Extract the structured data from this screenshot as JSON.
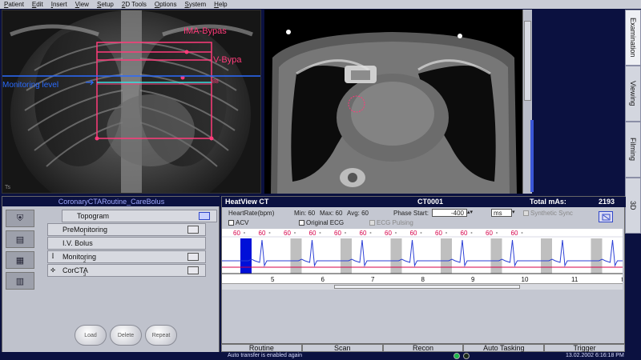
{
  "menu": [
    "Patient",
    "Edit",
    "Insert",
    "View",
    "Setup",
    "2D Tools",
    "Options",
    "System",
    "Help"
  ],
  "topogram": {
    "labels": {
      "ima_bypass": "IMA-Bypas",
      "v_bypass": "V-Bypa",
      "monitoring_level": "Monitoring level",
      "corner_mark": "Ts"
    },
    "colors": {
      "bypass": "#ff3b7a",
      "monitoring": "#2a6bff",
      "cyan": "#3ce0e0"
    }
  },
  "side_tabs": [
    "Examination",
    "Viewing",
    "Filming",
    "3D"
  ],
  "protocol": {
    "title": "CoronaryCTARoutine_CareBolus",
    "rows": [
      {
        "label": "Topogram",
        "num": "",
        "checked": true
      },
      {
        "label": "PreMonitoring",
        "num": "1",
        "checked": false
      },
      {
        "label": "I.V. Bolus",
        "num": "",
        "checked": false
      },
      {
        "label": "Monitoring",
        "num": "2",
        "checked": false
      },
      {
        "label": "CorCTA",
        "num": "3",
        "checked": false
      }
    ],
    "round_buttons": [
      "Load",
      "Delete",
      "Repeat"
    ]
  },
  "heartview": {
    "title": "HeatView CT",
    "id": "CT0001",
    "total_mas_label": "Total mAs:",
    "total_mas_value": "2193",
    "heart_rate_label": "HeartRate(bpm)",
    "min": "Min: 60",
    "max": "Max: 60",
    "avg": "Avg: 60",
    "phase_start_label": "Phase Start:",
    "phase_start_value": "-400",
    "phase_unit": "ms",
    "synthetic_sync": "Synthetic Sync",
    "acv": "ACV",
    "original_ecg": "Original ECG",
    "ecg_pulsing": "ECG Pulsing"
  },
  "ecg_data": {
    "hr_labels": [
      "60",
      "60",
      "60",
      "60",
      "60",
      "60",
      "60",
      "60",
      "60",
      "60",
      "60",
      "60"
    ],
    "beat_numbers": [
      "5",
      "6",
      "7",
      "8",
      "9",
      "10",
      "11",
      "t"
    ],
    "colors": {
      "trace": "#2b3fd6",
      "hr_line": "#d6004a",
      "window": "#bfbfbf",
      "active": "#0010d8"
    }
  },
  "bottom_tabs": [
    "Routine",
    "Scan",
    "Recon",
    "Auto Tasking",
    "Trigger"
  ],
  "status": {
    "message": "Auto transfer is enabled again",
    "datetime": "13.02.2002 6:16:18 PM"
  }
}
